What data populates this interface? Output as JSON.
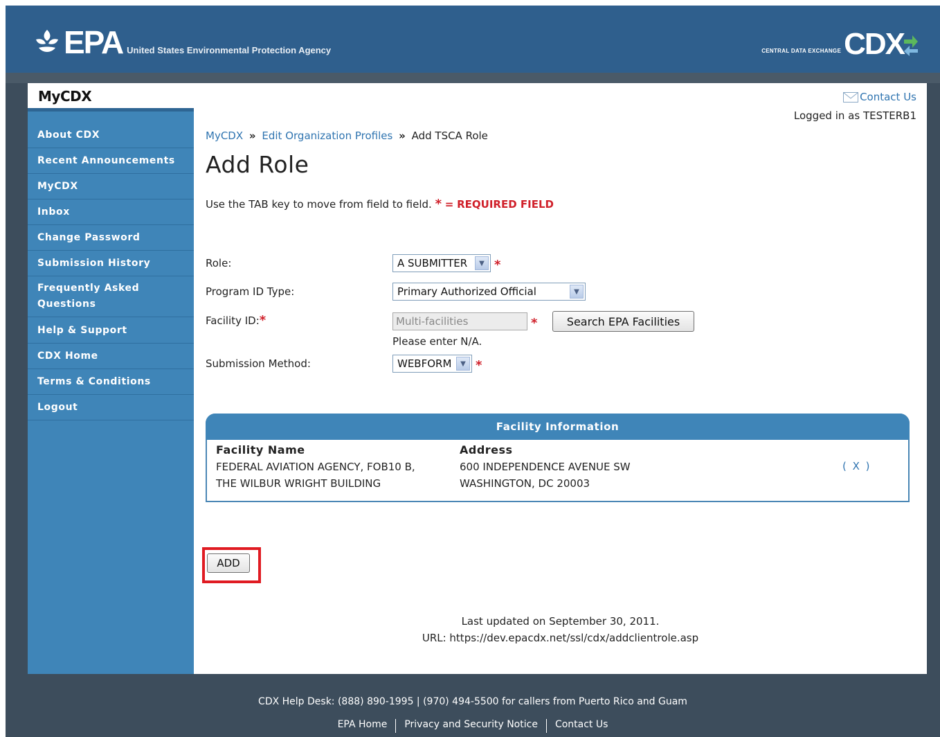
{
  "header": {
    "epa_mark": "EPA",
    "epa_subtitle": "United States Environmental Protection Agency",
    "cdx_subtitle": "CENTRAL DATA EXCHANGE",
    "cdx_mark": "CDX"
  },
  "sidebar": {
    "title": "MyCDX",
    "items": [
      {
        "label": "About CDX"
      },
      {
        "label": "Recent Announcements"
      },
      {
        "label": "MyCDX"
      },
      {
        "label": "Inbox"
      },
      {
        "label": "Change Password"
      },
      {
        "label": "Submission History"
      },
      {
        "label": "Frequently Asked Questions"
      },
      {
        "label": "Help & Support"
      },
      {
        "label": "CDX Home"
      },
      {
        "label": "Terms & Conditions"
      },
      {
        "label": "Logout"
      }
    ]
  },
  "topbar": {
    "contact_us": "Contact Us",
    "logged_in": "Logged in as TESTERB1"
  },
  "breadcrumb": {
    "items": [
      "MyCDX",
      "Edit Organization Profiles",
      "Add TSCA Role"
    ],
    "separator": "»"
  },
  "page": {
    "title": "Add Role",
    "instructions": "Use the TAB key to move from field to field.",
    "required_star": "*",
    "required_eq": "=",
    "required_label": "REQUIRED FIELD"
  },
  "form": {
    "role_label": "Role:",
    "role_value": "A SUBMITTER",
    "program_label": "Program ID Type:",
    "program_value": "Primary Authorized Official",
    "facility_label": "Facility ID:",
    "facility_value": "Multi-facilities",
    "search_button": "Search EPA Facilities",
    "facility_hint": "Please enter N/A.",
    "method_label": "Submission Method:",
    "method_value": "WEBFORM"
  },
  "facility": {
    "heading": "Facility Information",
    "name_header": "Facility Name",
    "name_line1": "FEDERAL AVIATION AGENCY, FOB10 B,",
    "name_line2": "THE WILBUR WRIGHT BUILDING",
    "address_header": "Address",
    "address_line1": "600 INDEPENDENCE AVENUE SW",
    "address_line2": "WASHINGTON, DC 20003",
    "remove": "( X )"
  },
  "actions": {
    "add_button": "ADD"
  },
  "meta": {
    "last_updated": "Last updated on September 30, 2011.",
    "url": "URL: https://dev.epacdx.net/ssl/cdx/addclientrole.asp"
  },
  "footer": {
    "helpdesk": "CDX Help Desk: (888) 890-1995 | (970) 494-5500 for callers from Puerto Rico and Guam",
    "links": [
      "EPA Home",
      "Privacy and Security Notice",
      "Contact Us"
    ]
  }
}
